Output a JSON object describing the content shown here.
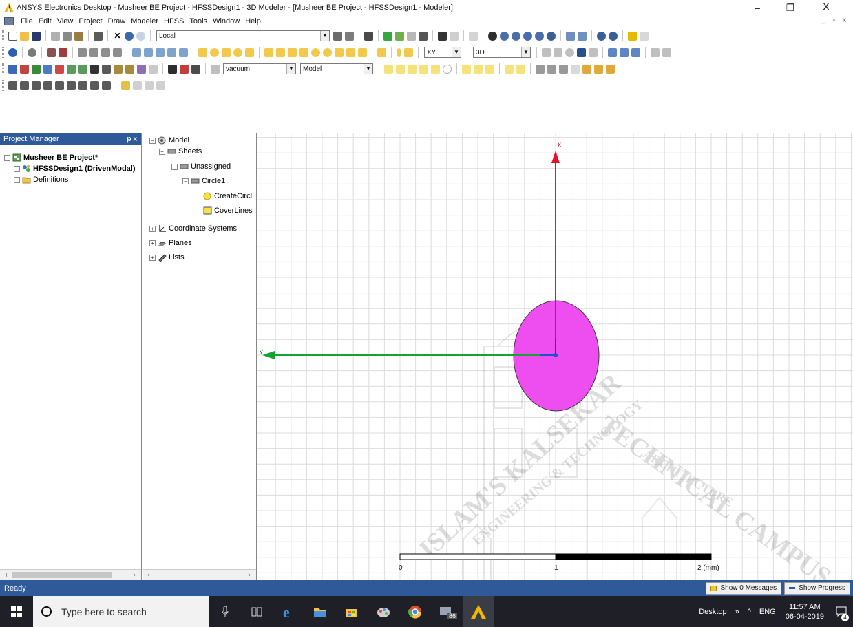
{
  "window": {
    "title": "ANSYS Electronics Desktop - Musheer BE Project - HFSSDesign1 - 3D Modeler - [Musheer BE Project - HFSSDesign1 - Modeler]",
    "minimize": "–",
    "maximize": "❐",
    "close": "X",
    "mdi_controls": "_ ▫ x"
  },
  "menu": [
    "File",
    "Edit",
    "View",
    "Project",
    "Draw",
    "Modeler",
    "HFSS",
    "Tools",
    "Window",
    "Help"
  ],
  "toolbar": {
    "coord_system": "Local",
    "plane": "XY",
    "view_mode": "3D",
    "material": "vacuum",
    "model_type": "Model"
  },
  "project_manager": {
    "title": "Project Manager",
    "header_controls": "ᵽ x",
    "project": "Musheer BE Project*",
    "design": "HFSSDesign1 (DrivenModal)",
    "definitions": "Definitions"
  },
  "model_tree": {
    "model": "Model",
    "sheets": "Sheets",
    "unassigned": "Unassigned",
    "circle": "Circle1",
    "create": "CreateCircl",
    "cover": "CoverLines",
    "coordinate_systems": "Coordinate Systems",
    "planes": "Planes",
    "lists": "Lists"
  },
  "viewport": {
    "axis_x_label": "x",
    "axis_y_label": "Y",
    "scale_0": "0",
    "scale_1": "1",
    "scale_2": "2 (mm)",
    "circle_color": "#ee4ef0",
    "x_axis_color": "#e8102a",
    "y_axis_color": "#18a030",
    "watermark_text": [
      "ISLAM'S KALSEKAR",
      "TECHNICAL CAMPUS",
      "ENGINEERING & TECHNOLOGY",
      "ARCHITECTURE"
    ]
  },
  "status": {
    "text": "Ready",
    "messages_button": "Show 0 Messages",
    "progress_button": "Show Progress"
  },
  "taskbar": {
    "search_placeholder": "Type here to search",
    "badge_count": "86",
    "desktop_label": "Desktop",
    "chevron": "»",
    "caret": "^",
    "language": "ENG",
    "time": "11:57 AM",
    "date": "06-04-2019",
    "notification_count": "4"
  },
  "colors": {
    "header_blue": "#2f5a9a",
    "taskbar": "#1e1f27",
    "grid": "#dcdcdc"
  }
}
